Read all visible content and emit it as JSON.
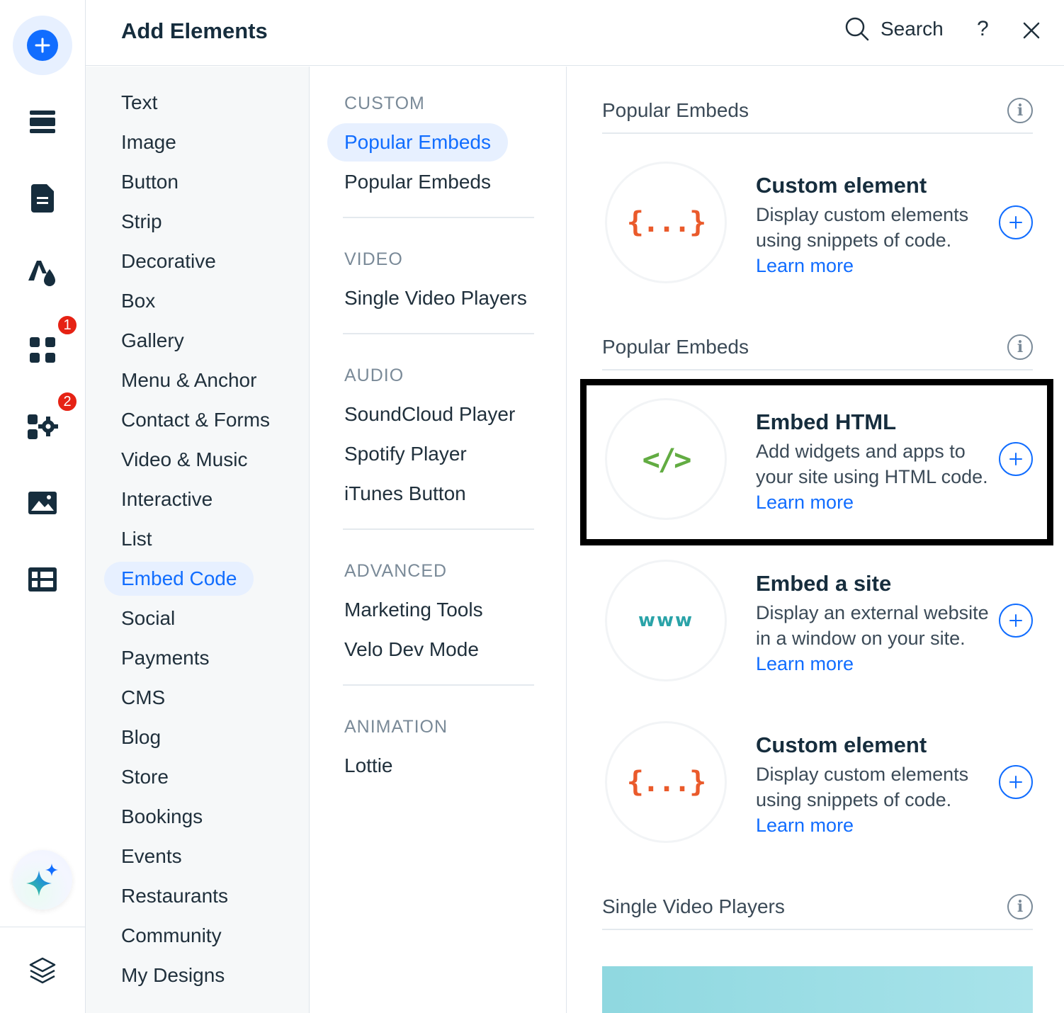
{
  "rail": {
    "badge_apps": "1",
    "badge_business": "2",
    "accent": "#116dff",
    "badge_color": "#e62214"
  },
  "header": {
    "title": "Add Elements",
    "search_label": "Search",
    "help_label": "?"
  },
  "categories": [
    "Text",
    "Image",
    "Button",
    "Strip",
    "Decorative",
    "Box",
    "Gallery",
    "Menu & Anchor",
    "Contact & Forms",
    "Video & Music",
    "Interactive",
    "List",
    "Embed Code",
    "Social",
    "Payments",
    "CMS",
    "Blog",
    "Store",
    "Bookings",
    "Events",
    "Restaurants",
    "Community",
    "My Designs"
  ],
  "active_category": "Embed Code",
  "subcategories": {
    "custom": {
      "heading": "CUSTOM",
      "items": [
        "Popular Embeds",
        "Popular Embeds"
      ]
    },
    "video": {
      "heading": "VIDEO",
      "items": [
        "Single Video Players"
      ]
    },
    "audio": {
      "heading": "AUDIO",
      "items": [
        "SoundCloud Player",
        "Spotify Player",
        "iTunes Button"
      ]
    },
    "advanced": {
      "heading": "ADVANCED",
      "items": [
        "Marketing Tools",
        "Velo Dev Mode"
      ]
    },
    "animation": {
      "heading": "ANIMATION",
      "items": [
        "Lottie"
      ]
    }
  },
  "content": {
    "group1_title": "Popular Embeds",
    "group2_title": "Popular Embeds",
    "group3_title": "Single Video Players",
    "info_glyph": "i",
    "learn_more": "Learn more",
    "cards": [
      {
        "title": "Custom element",
        "desc": "Display custom elements using snippets of code.",
        "symbol": "{...}"
      },
      {
        "title": "Embed HTML",
        "desc": "Add widgets and apps to your site using HTML code.",
        "symbol": "</>"
      },
      {
        "title": "Embed a site",
        "desc": "Display an external website in a window on your site.",
        "symbol": "www"
      },
      {
        "title": "Custom element",
        "desc": "Display custom elements using snippets of code.",
        "symbol": "{...}"
      }
    ]
  }
}
